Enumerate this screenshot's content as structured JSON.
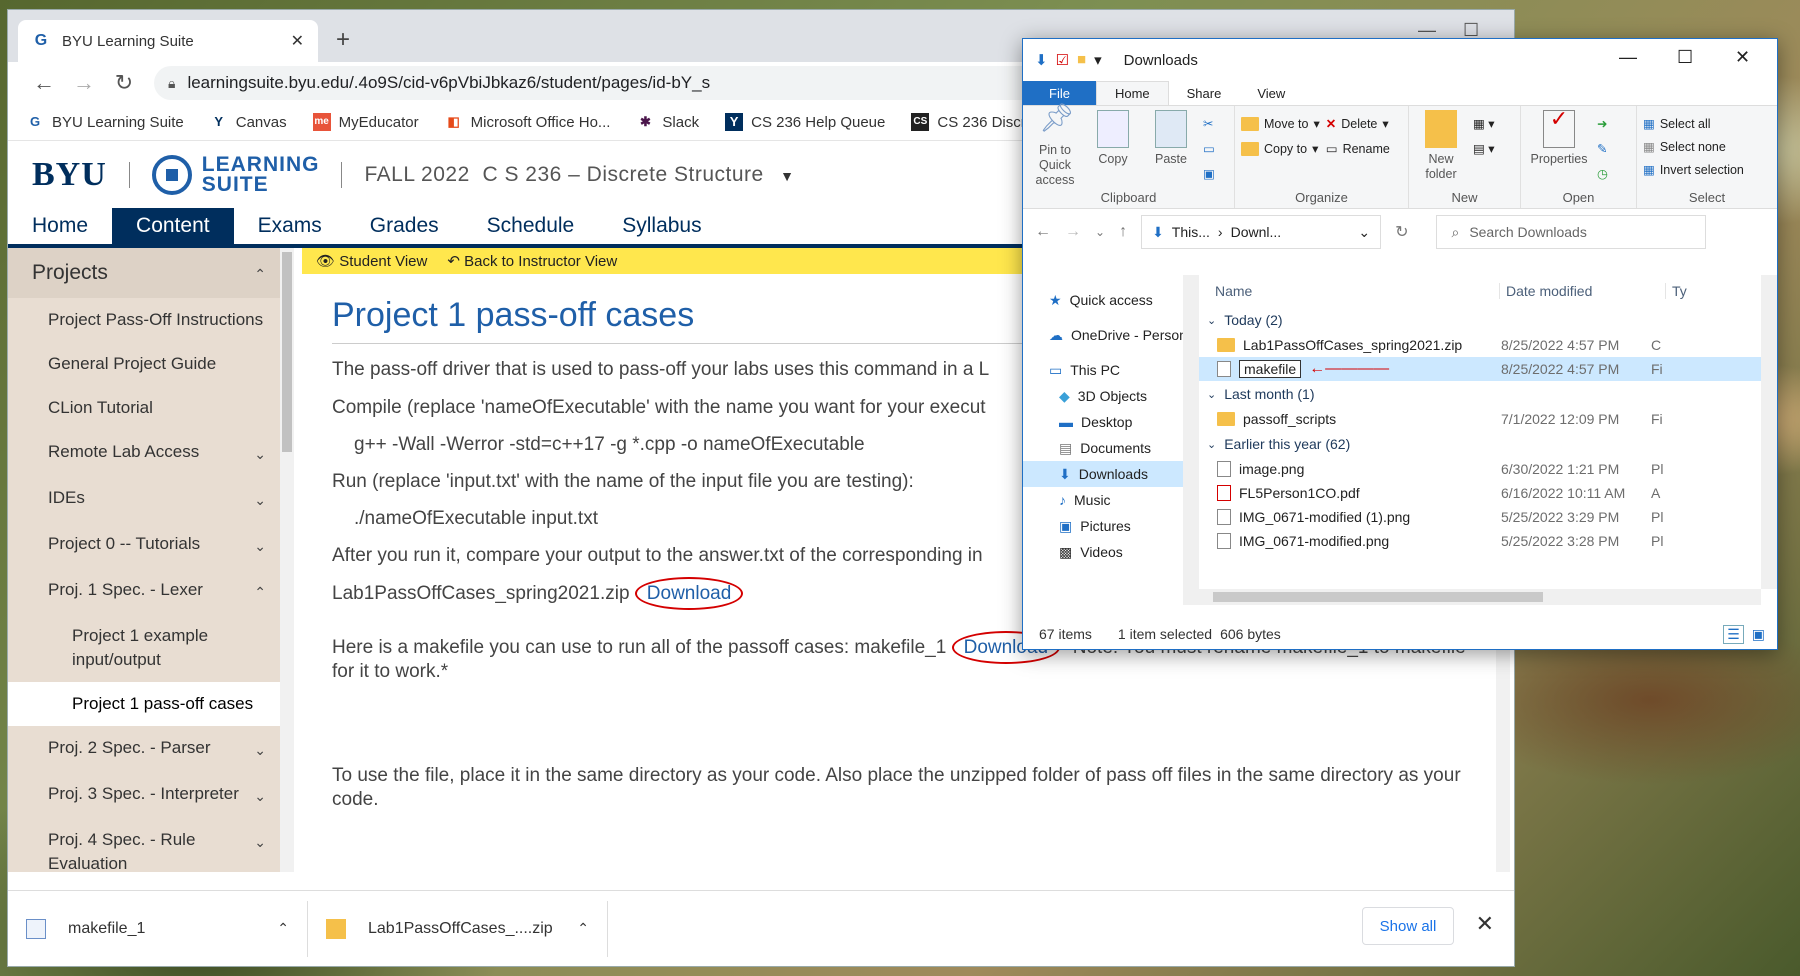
{
  "browser": {
    "tab_title": "BYU Learning Suite",
    "url": "learningsuite.byu.edu/.4o9S/cid-v6pVbiJbkaz6/student/pages/id-bY_s",
    "bookmarks": [
      "BYU Learning Suite",
      "Canvas",
      "MyEducator",
      "Microsoft Office Ho...",
      "Slack",
      "CS 236 Help Queue",
      "CS 236 Discrete"
    ]
  },
  "site": {
    "logo": "BYU",
    "suite_line1": "LEARNING",
    "suite_line2": "SUITE",
    "term": "FALL 2022",
    "course": "C S 236 – Discrete Structure"
  },
  "nav": [
    "Home",
    "Content",
    "Exams",
    "Grades",
    "Schedule",
    "Syllabus"
  ],
  "sidebar": {
    "heading": "Projects",
    "items": [
      {
        "label": "Project Pass-Off Instructions"
      },
      {
        "label": "General Project Guide"
      },
      {
        "label": "CLion Tutorial"
      },
      {
        "label": "Remote Lab Access"
      },
      {
        "label": "IDEs"
      },
      {
        "label": "Project 0 -- Tutorials"
      },
      {
        "label": "Proj. 1 Spec. - Lexer"
      },
      {
        "label": "Project 1 example input/output"
      },
      {
        "label": "Project 1 pass-off cases"
      },
      {
        "label": "Proj. 2 Spec. - Parser"
      },
      {
        "label": "Proj. 3 Spec. - Interpreter"
      },
      {
        "label": "Proj. 4 Spec. - Rule Evaluation"
      }
    ]
  },
  "viewbar": {
    "student_view": "Student View",
    "back": "Back to Instructor View"
  },
  "page": {
    "title": "Project 1 pass-off cases",
    "p1": "The pass-off driver that is used to pass-off your labs uses this command in a L",
    "p2": "Compile (replace 'nameOfExecutable' with the name you want for your execut",
    "code1": "g++ -Wall -Werror -std=c++17 -g *.cpp -o nameOfExecutable",
    "p3": "Run (replace 'input.txt' with the name of the input file you are testing):",
    "code2": "./nameOfExecutable input.txt",
    "p4": "After you run it, compare your output to the answer.txt of the corresponding in",
    "zip_name": "Lab1PassOffCases_spring2021.zip",
    "download": "Download",
    "p5_a": "Here is a makefile you can use to run all of the passoff cases: makefile_1",
    "p5_b": "*Note: You must rename makefile_1 to makefile for it to work.*",
    "p6": "To use the file, place it in the same directory as your code. Also place the unzipped folder of pass off files in the same directory as your code."
  },
  "downloads": {
    "items": [
      "makefile_1",
      "Lab1PassOffCases_....zip"
    ],
    "show_all": "Show all"
  },
  "explorer": {
    "title": "Downloads",
    "tabs": [
      "File",
      "Home",
      "Share",
      "View"
    ],
    "ribbon": {
      "pin": "Pin to Quick access",
      "copy": "Copy",
      "paste": "Paste",
      "clipboard": "Clipboard",
      "move_to": "Move to",
      "copy_to": "Copy to",
      "delete": "Delete",
      "rename": "Rename",
      "organize": "Organize",
      "new_folder": "New folder",
      "new": "New",
      "properties": "Properties",
      "open": "Open",
      "select_all": "Select all",
      "select_none": "Select none",
      "invert": "Invert selection",
      "select": "Select"
    },
    "path": [
      "This...",
      "Downl..."
    ],
    "search_placeholder": "Search Downloads",
    "tree": [
      "Quick access",
      "OneDrive - Person",
      "This PC",
      "3D Objects",
      "Desktop",
      "Documents",
      "Downloads",
      "Music",
      "Pictures",
      "Videos"
    ],
    "columns": {
      "name": "Name",
      "date": "Date modified",
      "type": "Ty"
    },
    "groups": [
      {
        "label": "Today (2)",
        "rows": [
          {
            "name": "Lab1PassOffCases_spring2021.zip",
            "date": "8/25/2022 4:57 PM",
            "type": "C"
          },
          {
            "name": "makefile",
            "date": "8/25/2022 4:57 PM",
            "type": "Fi"
          }
        ]
      },
      {
        "label": "Last month (1)",
        "rows": [
          {
            "name": "passoff_scripts",
            "date": "7/1/2022 12:09 PM",
            "type": "Fi"
          }
        ]
      },
      {
        "label": "Earlier this year (62)",
        "rows": [
          {
            "name": "image.png",
            "date": "6/30/2022 1:21 PM",
            "type": "Pl"
          },
          {
            "name": "FL5Person1CO.pdf",
            "date": "6/16/2022 10:11 AM",
            "type": "A"
          },
          {
            "name": "IMG_0671-modified (1).png",
            "date": "5/25/2022 3:29 PM",
            "type": "Pl"
          },
          {
            "name": "IMG_0671-modified.png",
            "date": "5/25/2022 3:28 PM",
            "type": "Pl"
          }
        ]
      }
    ],
    "status": {
      "count": "67 items",
      "selected": "1 item selected",
      "size": "606 bytes"
    }
  }
}
